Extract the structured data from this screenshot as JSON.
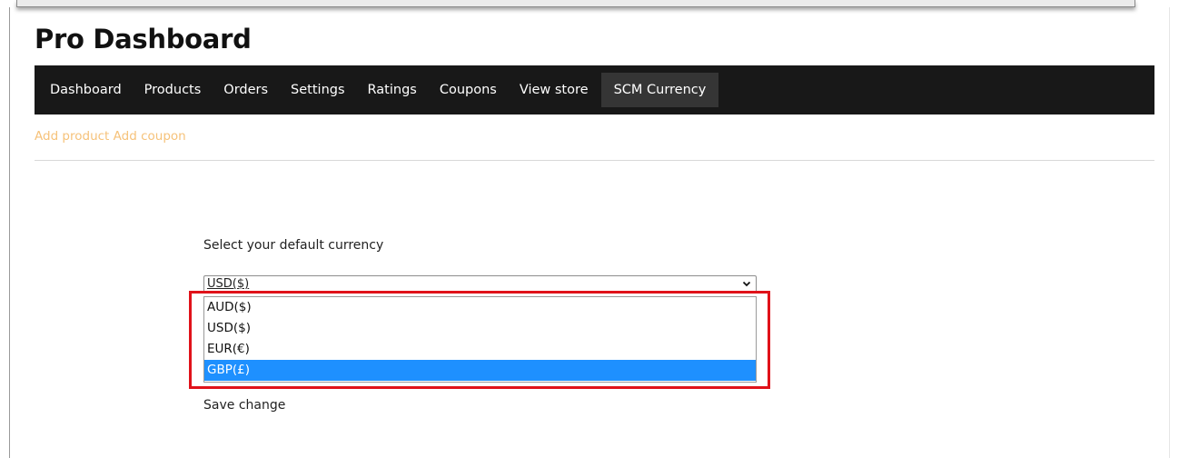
{
  "header": {
    "title": "Pro Dashboard"
  },
  "nav": {
    "items": [
      {
        "label": "Dashboard"
      },
      {
        "label": "Products"
      },
      {
        "label": "Orders"
      },
      {
        "label": "Settings"
      },
      {
        "label": "Ratings"
      },
      {
        "label": "Coupons"
      },
      {
        "label": "View store"
      },
      {
        "label": "SCM Currency",
        "active": true
      }
    ]
  },
  "sub_links": {
    "add_product": "Add product",
    "add_coupon": "Add coupon"
  },
  "currency": {
    "label": "Select your default currency",
    "selected_value": "USD($)",
    "options": [
      "AUD($)",
      "USD($)",
      "EUR(€)",
      "GBP(£)"
    ],
    "highlighted_option": "GBP(£)",
    "save_label": "Save change"
  },
  "colors": {
    "nav_bg": "#181818",
    "nav_active_bg": "#353535",
    "link_color": "#f6c27a",
    "option_highlight": "#1e90ff",
    "annotation_border": "#e0121a"
  },
  "icons": {
    "select_caret": "chevron-down-icon"
  }
}
